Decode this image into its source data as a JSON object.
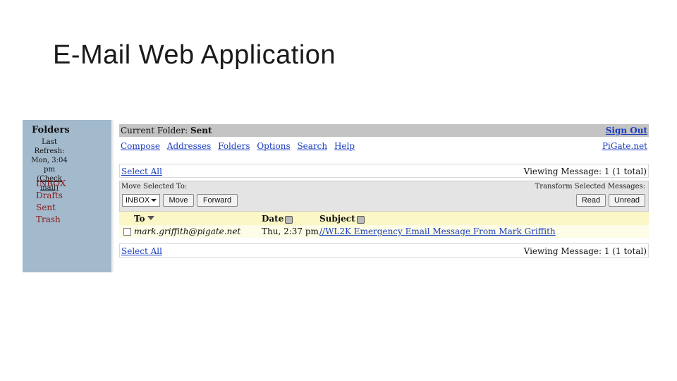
{
  "slide": {
    "title": "E-Mail Web Application"
  },
  "sidebar": {
    "title": "Folders",
    "refresh_label": "Last Refresh:",
    "refresh_time": "Mon, 3:04 pm",
    "check_mail": "(Check mail)",
    "folders": [
      "INBOX",
      "Drafts",
      "Sent",
      "Trash"
    ]
  },
  "header": {
    "current_folder_label": "Current Folder:",
    "current_folder": "Sent",
    "sign_out": "Sign Out"
  },
  "nav": {
    "links": [
      "Compose",
      "Addresses",
      "Folders",
      "Options",
      "Search",
      "Help"
    ],
    "site": "PiGate.net"
  },
  "top_bar": {
    "select_all": "Select All",
    "viewing": "Viewing Message: 1 (1 total)"
  },
  "toolbar": {
    "move_label": "Move Selected To:",
    "transform_label": "Transform Selected Messages:",
    "folder_select": "INBOX",
    "move_button": "Move",
    "forward_button": "Forward",
    "read_button": "Read",
    "unread_button": "Unread"
  },
  "table": {
    "columns": [
      "To",
      "Date",
      "Subject"
    ],
    "rows": [
      {
        "to": "mark.griffith@pigate.net",
        "date": "Thu, 2:37 pm",
        "subject": "//WL2K Emergency Email Message From Mark Griffith"
      }
    ]
  },
  "bottom_bar": {
    "select_all": "Select All",
    "viewing": "Viewing Message: 1 (1 total)"
  }
}
